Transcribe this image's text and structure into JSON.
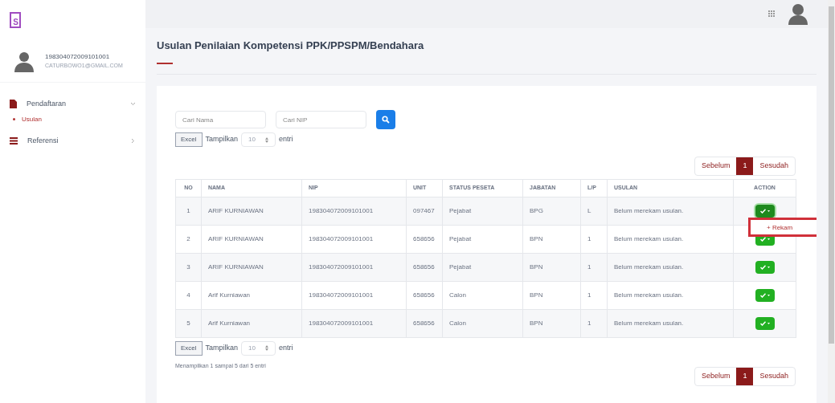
{
  "logo": {
    "letter": "S"
  },
  "user": {
    "nip": "198304072009101001",
    "email": "CATURBOWO1@GMAIL.COM"
  },
  "sidebar": {
    "items": [
      {
        "label": "Pendaftaran",
        "kind": "document",
        "expanded": true,
        "children": [
          {
            "label": "Usulan",
            "selected": true
          }
        ]
      },
      {
        "label": "Referensi",
        "kind": "list",
        "expanded": false
      }
    ]
  },
  "page_title": "Usulan Penilaian Kompetensi PPK/PPSPM/Bendahara",
  "search": {
    "name_placeholder": "Cari Nama",
    "nip_placeholder": "Cari NIP"
  },
  "table_top": {
    "excel": "Excel",
    "show": "Tampilkan",
    "page_size": "10",
    "entries": "entri"
  },
  "pagination": {
    "prev": "Sebelum",
    "pages": [
      {
        "label": "1",
        "selected": true
      }
    ],
    "next": "Sesudah"
  },
  "table": {
    "columns": [
      "NO",
      "NAMA",
      "NIP",
      "UNIT",
      "STATUS PESETA",
      "JABATAN",
      "L/P",
      "USULAN",
      "ACTION"
    ],
    "rows": [
      {
        "cells": [
          "1",
          "ARIF KURNIAWAN",
          "198304072009101001",
          "097467",
          "Pejabat",
          "BPG",
          "L",
          "Belum merekam usulan."
        ],
        "open": true
      },
      {
        "cells": [
          "2",
          "ARIF KURNIAWAN",
          "198304072009101001",
          "658656",
          "Pejabat",
          "BPN",
          "1",
          "Belum merekam usulan."
        ],
        "open": false
      },
      {
        "cells": [
          "3",
          "ARIF KURNIAWAN",
          "198304072009101001",
          "658656",
          "Pejabat",
          "BPN",
          "1",
          "Belum merekam usulan."
        ],
        "open": false
      },
      {
        "cells": [
          "4",
          "Arif Kurniawan",
          "198304072009101001",
          "658656",
          "Calon",
          "BPN",
          "1",
          "Belum merekam usulan."
        ],
        "open": false
      },
      {
        "cells": [
          "5",
          "Arif Kurniawan",
          "198304072009101001",
          "658656",
          "Calon",
          "BPN",
          "1",
          "Belum merekam usulan."
        ],
        "open": false
      }
    ]
  },
  "action_menu": {
    "items": [
      "+ Rekam"
    ]
  },
  "table_bottom": {
    "excel": "Excel",
    "show": "Tampilkan",
    "page_size": "10",
    "entries": "entri",
    "info": "Menampilkan 1 sampai 5 dari 5 entri"
  },
  "pagination_bottom": {
    "prev": "Sebelum",
    "pages": [
      {
        "label": "1",
        "selected": true
      }
    ],
    "next": "Sesudah"
  }
}
